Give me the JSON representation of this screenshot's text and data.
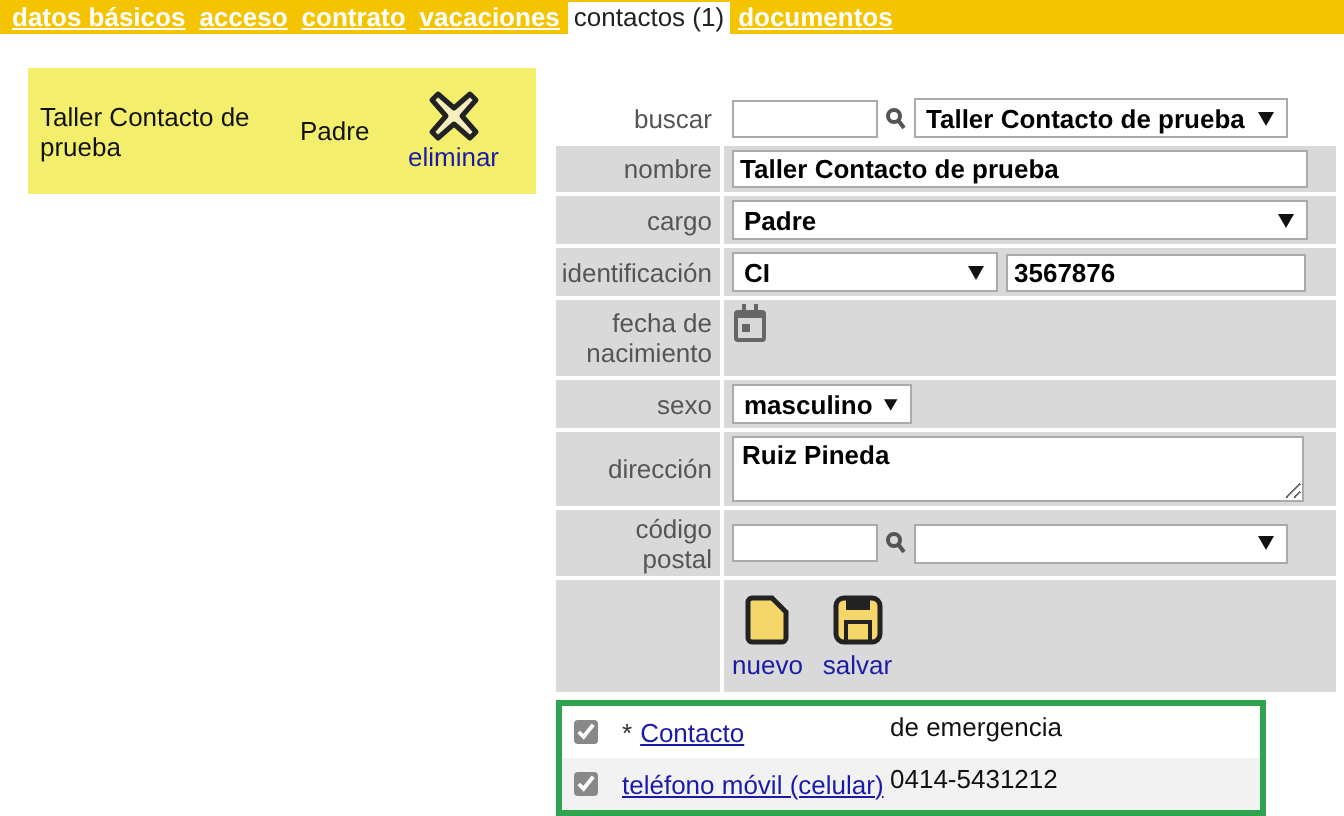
{
  "tabs": [
    {
      "label": "datos básicos",
      "selected": false
    },
    {
      "label": "acceso",
      "selected": false
    },
    {
      "label": "contrato",
      "selected": false
    },
    {
      "label": "vacaciones",
      "selected": false
    },
    {
      "label": "contactos (1)",
      "selected": true
    },
    {
      "label": "documentos",
      "selected": false
    }
  ],
  "contact_card": {
    "name": "Taller Contacto de prueba",
    "role": "Padre",
    "delete_label": "eliminar"
  },
  "form": {
    "search": {
      "label": "buscar",
      "selected_option": "Taller Contacto de prueba"
    },
    "fields": [
      {
        "kind": "text",
        "label": "nombre",
        "value": "Taller Contacto de prueba"
      },
      {
        "kind": "select",
        "label": "cargo",
        "value": "Padre"
      },
      {
        "kind": "id",
        "label": "identificación",
        "type_value": "CI",
        "value": "3567876"
      },
      {
        "kind": "date",
        "label": "fecha de nacimiento"
      },
      {
        "kind": "small_select",
        "label": "sexo",
        "value": "masculino"
      },
      {
        "kind": "textarea",
        "label": "dirección",
        "value": "Ruiz Pineda"
      },
      {
        "kind": "lookup",
        "label": "código postal"
      }
    ],
    "actions": [
      {
        "kind": "new",
        "label": "nuevo"
      },
      {
        "kind": "save",
        "label": "salvar"
      }
    ]
  },
  "contact_types": [
    {
      "prefix": "*",
      "link": "Contacto",
      "value": "de emergencia",
      "checked": true
    },
    {
      "link": "teléfono móvil (celular)",
      "value": "0414-5431212",
      "checked": true
    }
  ]
}
